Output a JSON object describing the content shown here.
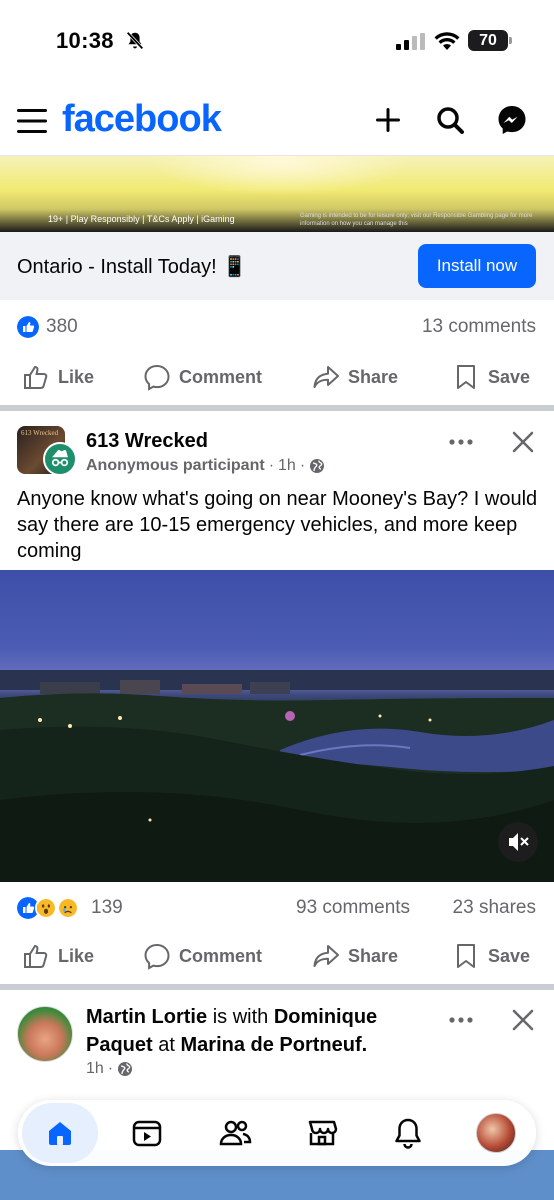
{
  "status_bar": {
    "time": "10:38",
    "battery": "70"
  },
  "header": {
    "logo": "facebook",
    "icons": [
      "menu-icon",
      "plus-icon",
      "search-icon",
      "messenger-icon"
    ]
  },
  "ad": {
    "disclaimer": "19+ | Play Responsibly | T&Cs Apply | iGaming",
    "disclaimer_small": "Gaming is intended to be for leisure only; visit our Responsible Gambling page for more information on how you can manage this",
    "cta_text": "Ontario - Install Today! 📱",
    "install_label": "Install now",
    "reaction_count": "380",
    "comments": "13 comments"
  },
  "actions": {
    "like": "Like",
    "comment": "Comment",
    "share": "Share",
    "save": "Save"
  },
  "post": {
    "group_name": "613 Wrecked",
    "group_thumb_text": "613 Wrecked",
    "author": "Anonymous participant",
    "time": "1h",
    "text": "Anyone know what's going on near Mooney's Bay? I would say there are 10-15 emergency vehicles, and more keep coming",
    "reaction_count": "139",
    "comments": "93 comments",
    "shares": "23 shares"
  },
  "post2": {
    "author": "Martin Lortie",
    "is_with": "is with",
    "with_name_a": "Dominique",
    "with_name_b": "Paquet",
    "at": "at",
    "place": "Marina de Portneuf.",
    "time": "1h"
  },
  "bottom_nav": [
    "home-icon",
    "video-icon",
    "friends-icon",
    "marketplace-icon",
    "notifications-icon",
    "profile-avatar"
  ],
  "colors": {
    "brand": "#0866ff",
    "secondary_text": "#65676b"
  }
}
